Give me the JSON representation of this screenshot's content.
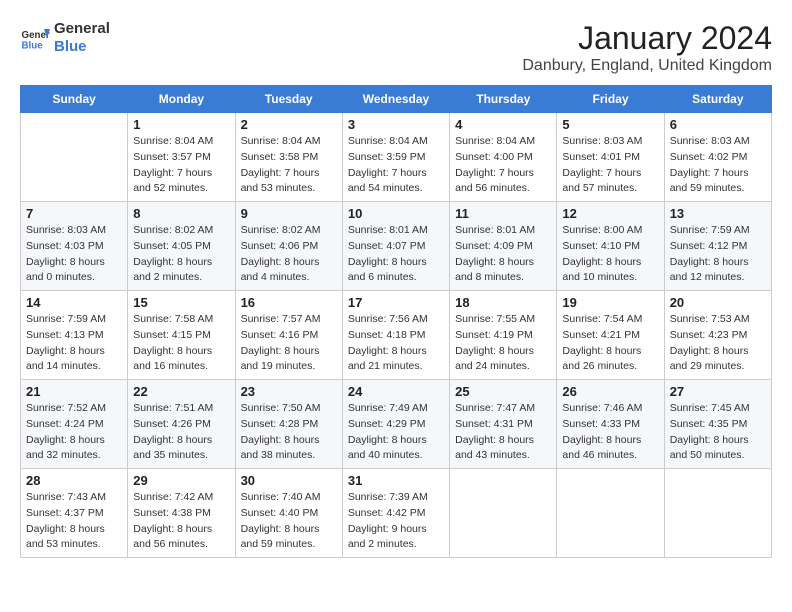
{
  "header": {
    "logo_general": "General",
    "logo_blue": "Blue",
    "title": "January 2024",
    "subtitle": "Danbury, England, United Kingdom"
  },
  "calendar": {
    "days_of_week": [
      "Sunday",
      "Monday",
      "Tuesday",
      "Wednesday",
      "Thursday",
      "Friday",
      "Saturday"
    ],
    "weeks": [
      [
        {
          "day": "",
          "sunrise": "",
          "sunset": "",
          "daylight": ""
        },
        {
          "day": "1",
          "sunrise": "Sunrise: 8:04 AM",
          "sunset": "Sunset: 3:57 PM",
          "daylight": "Daylight: 7 hours and 52 minutes."
        },
        {
          "day": "2",
          "sunrise": "Sunrise: 8:04 AM",
          "sunset": "Sunset: 3:58 PM",
          "daylight": "Daylight: 7 hours and 53 minutes."
        },
        {
          "day": "3",
          "sunrise": "Sunrise: 8:04 AM",
          "sunset": "Sunset: 3:59 PM",
          "daylight": "Daylight: 7 hours and 54 minutes."
        },
        {
          "day": "4",
          "sunrise": "Sunrise: 8:04 AM",
          "sunset": "Sunset: 4:00 PM",
          "daylight": "Daylight: 7 hours and 56 minutes."
        },
        {
          "day": "5",
          "sunrise": "Sunrise: 8:03 AM",
          "sunset": "Sunset: 4:01 PM",
          "daylight": "Daylight: 7 hours and 57 minutes."
        },
        {
          "day": "6",
          "sunrise": "Sunrise: 8:03 AM",
          "sunset": "Sunset: 4:02 PM",
          "daylight": "Daylight: 7 hours and 59 minutes."
        }
      ],
      [
        {
          "day": "7",
          "sunrise": "Sunrise: 8:03 AM",
          "sunset": "Sunset: 4:03 PM",
          "daylight": "Daylight: 8 hours and 0 minutes."
        },
        {
          "day": "8",
          "sunrise": "Sunrise: 8:02 AM",
          "sunset": "Sunset: 4:05 PM",
          "daylight": "Daylight: 8 hours and 2 minutes."
        },
        {
          "day": "9",
          "sunrise": "Sunrise: 8:02 AM",
          "sunset": "Sunset: 4:06 PM",
          "daylight": "Daylight: 8 hours and 4 minutes."
        },
        {
          "day": "10",
          "sunrise": "Sunrise: 8:01 AM",
          "sunset": "Sunset: 4:07 PM",
          "daylight": "Daylight: 8 hours and 6 minutes."
        },
        {
          "day": "11",
          "sunrise": "Sunrise: 8:01 AM",
          "sunset": "Sunset: 4:09 PM",
          "daylight": "Daylight: 8 hours and 8 minutes."
        },
        {
          "day": "12",
          "sunrise": "Sunrise: 8:00 AM",
          "sunset": "Sunset: 4:10 PM",
          "daylight": "Daylight: 8 hours and 10 minutes."
        },
        {
          "day": "13",
          "sunrise": "Sunrise: 7:59 AM",
          "sunset": "Sunset: 4:12 PM",
          "daylight": "Daylight: 8 hours and 12 minutes."
        }
      ],
      [
        {
          "day": "14",
          "sunrise": "Sunrise: 7:59 AM",
          "sunset": "Sunset: 4:13 PM",
          "daylight": "Daylight: 8 hours and 14 minutes."
        },
        {
          "day": "15",
          "sunrise": "Sunrise: 7:58 AM",
          "sunset": "Sunset: 4:15 PM",
          "daylight": "Daylight: 8 hours and 16 minutes."
        },
        {
          "day": "16",
          "sunrise": "Sunrise: 7:57 AM",
          "sunset": "Sunset: 4:16 PM",
          "daylight": "Daylight: 8 hours and 19 minutes."
        },
        {
          "day": "17",
          "sunrise": "Sunrise: 7:56 AM",
          "sunset": "Sunset: 4:18 PM",
          "daylight": "Daylight: 8 hours and 21 minutes."
        },
        {
          "day": "18",
          "sunrise": "Sunrise: 7:55 AM",
          "sunset": "Sunset: 4:19 PM",
          "daylight": "Daylight: 8 hours and 24 minutes."
        },
        {
          "day": "19",
          "sunrise": "Sunrise: 7:54 AM",
          "sunset": "Sunset: 4:21 PM",
          "daylight": "Daylight: 8 hours and 26 minutes."
        },
        {
          "day": "20",
          "sunrise": "Sunrise: 7:53 AM",
          "sunset": "Sunset: 4:23 PM",
          "daylight": "Daylight: 8 hours and 29 minutes."
        }
      ],
      [
        {
          "day": "21",
          "sunrise": "Sunrise: 7:52 AM",
          "sunset": "Sunset: 4:24 PM",
          "daylight": "Daylight: 8 hours and 32 minutes."
        },
        {
          "day": "22",
          "sunrise": "Sunrise: 7:51 AM",
          "sunset": "Sunset: 4:26 PM",
          "daylight": "Daylight: 8 hours and 35 minutes."
        },
        {
          "day": "23",
          "sunrise": "Sunrise: 7:50 AM",
          "sunset": "Sunset: 4:28 PM",
          "daylight": "Daylight: 8 hours and 38 minutes."
        },
        {
          "day": "24",
          "sunrise": "Sunrise: 7:49 AM",
          "sunset": "Sunset: 4:29 PM",
          "daylight": "Daylight: 8 hours and 40 minutes."
        },
        {
          "day": "25",
          "sunrise": "Sunrise: 7:47 AM",
          "sunset": "Sunset: 4:31 PM",
          "daylight": "Daylight: 8 hours and 43 minutes."
        },
        {
          "day": "26",
          "sunrise": "Sunrise: 7:46 AM",
          "sunset": "Sunset: 4:33 PM",
          "daylight": "Daylight: 8 hours and 46 minutes."
        },
        {
          "day": "27",
          "sunrise": "Sunrise: 7:45 AM",
          "sunset": "Sunset: 4:35 PM",
          "daylight": "Daylight: 8 hours and 50 minutes."
        }
      ],
      [
        {
          "day": "28",
          "sunrise": "Sunrise: 7:43 AM",
          "sunset": "Sunset: 4:37 PM",
          "daylight": "Daylight: 8 hours and 53 minutes."
        },
        {
          "day": "29",
          "sunrise": "Sunrise: 7:42 AM",
          "sunset": "Sunset: 4:38 PM",
          "daylight": "Daylight: 8 hours and 56 minutes."
        },
        {
          "day": "30",
          "sunrise": "Sunrise: 7:40 AM",
          "sunset": "Sunset: 4:40 PM",
          "daylight": "Daylight: 8 hours and 59 minutes."
        },
        {
          "day": "31",
          "sunrise": "Sunrise: 7:39 AM",
          "sunset": "Sunset: 4:42 PM",
          "daylight": "Daylight: 9 hours and 2 minutes."
        },
        {
          "day": "",
          "sunrise": "",
          "sunset": "",
          "daylight": ""
        },
        {
          "day": "",
          "sunrise": "",
          "sunset": "",
          "daylight": ""
        },
        {
          "day": "",
          "sunrise": "",
          "sunset": "",
          "daylight": ""
        }
      ]
    ]
  }
}
